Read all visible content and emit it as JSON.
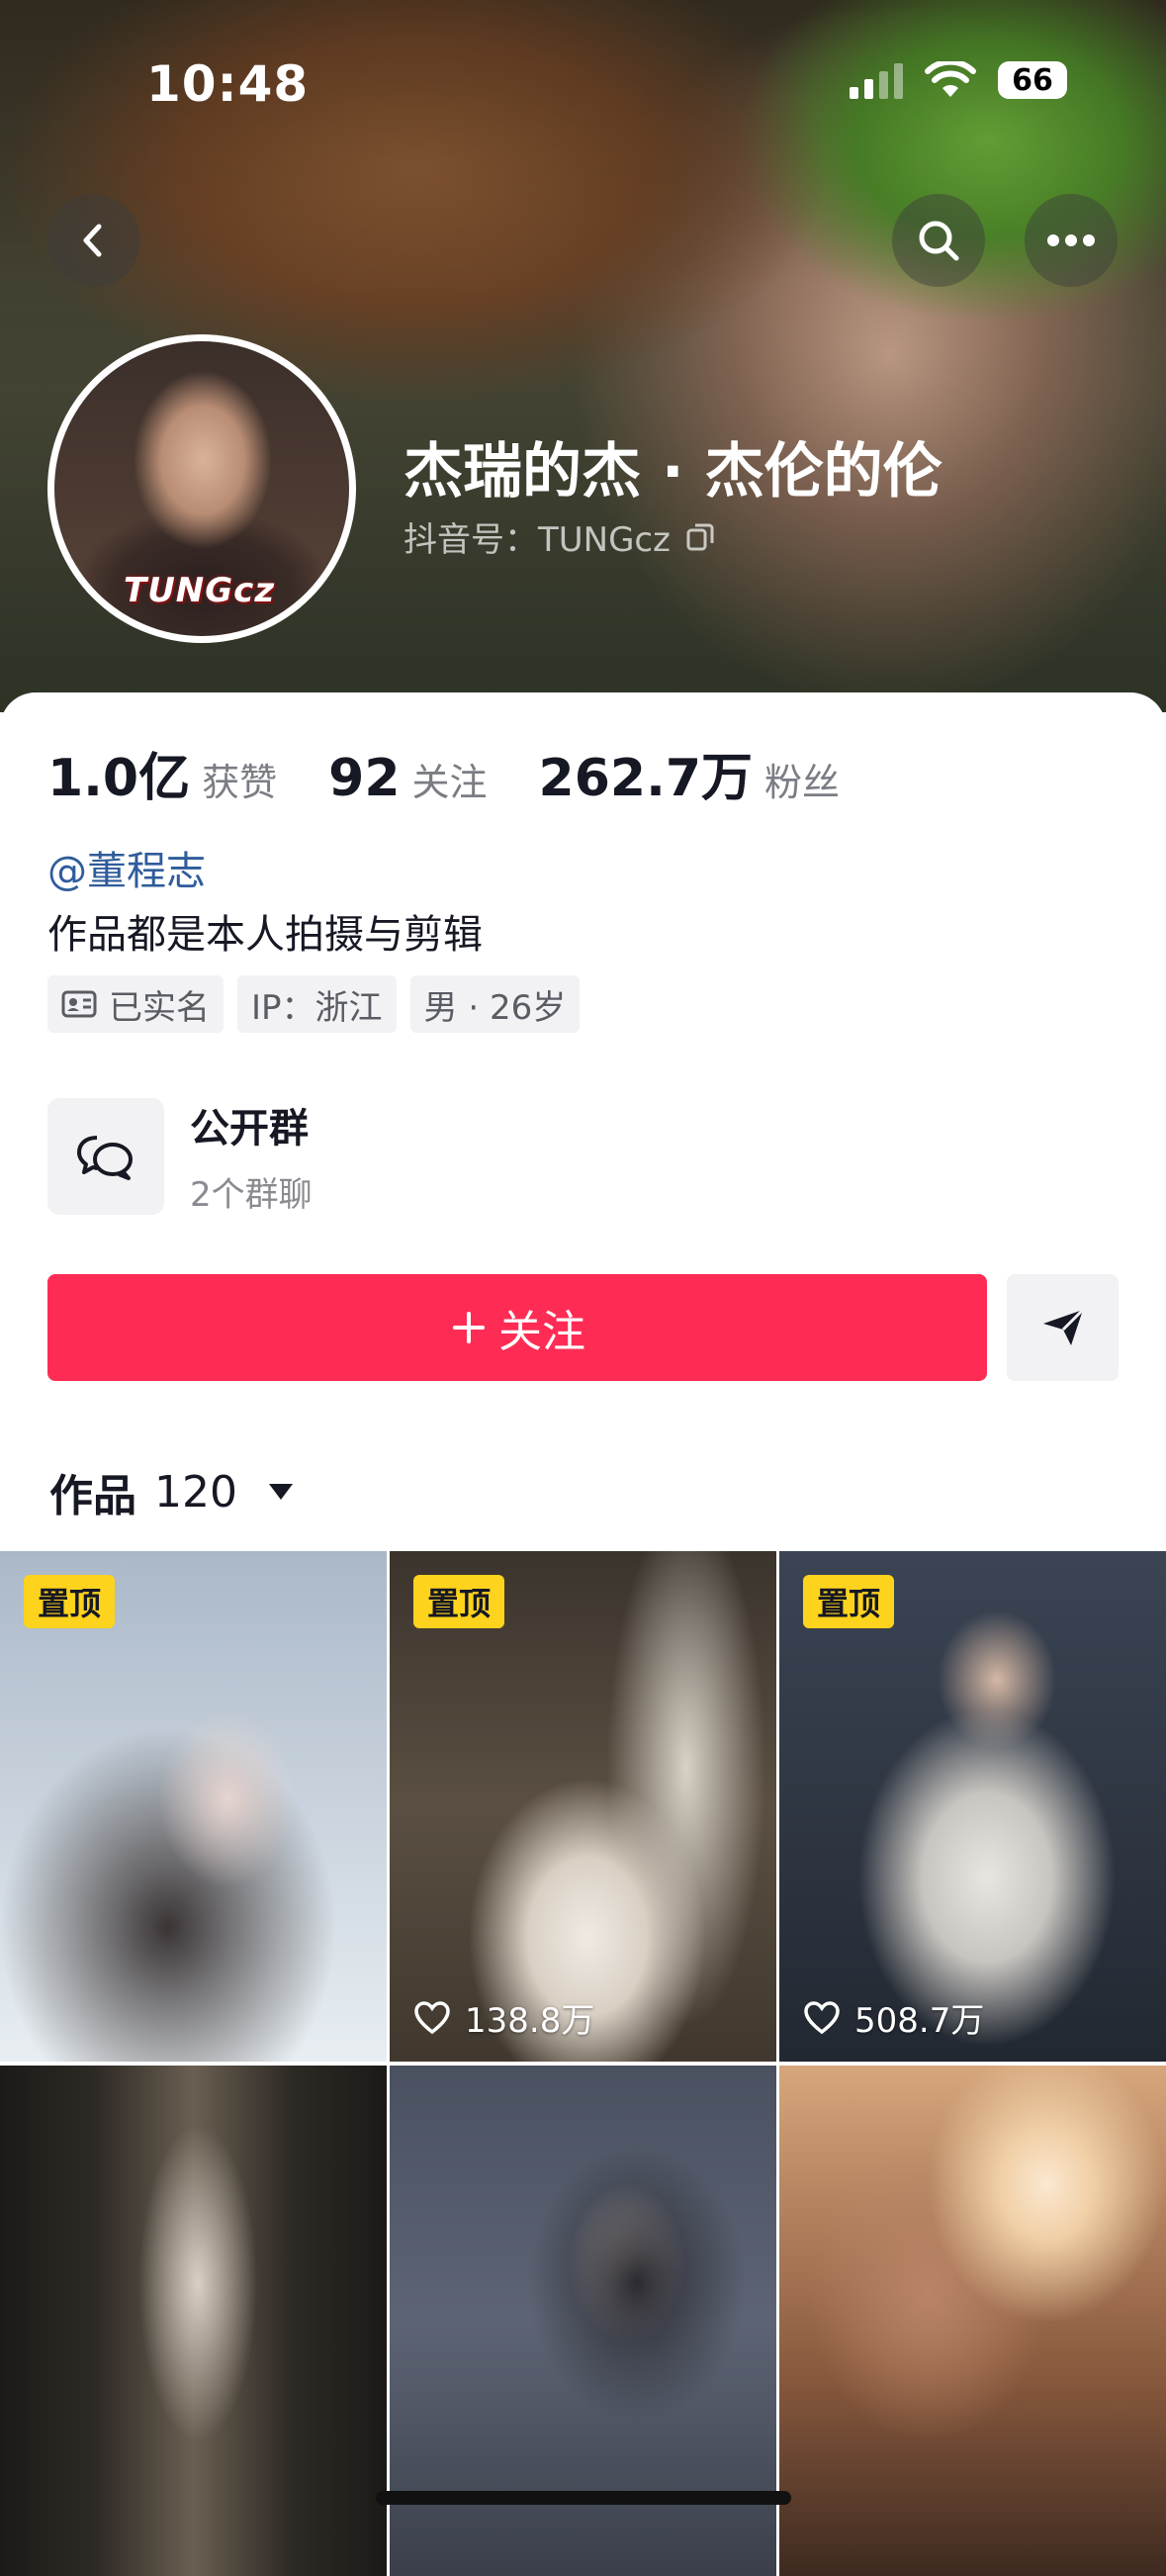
{
  "status_bar": {
    "time": "10:48",
    "battery": "66"
  },
  "profile": {
    "name": "杰瑞的杰 · 杰伦的伦",
    "douyin_id": "抖音号：TUNGcz",
    "avatar_logo": "TUNGcz",
    "stats": [
      {
        "value": "1.0亿",
        "label": "获赞"
      },
      {
        "value": "92",
        "label": "关注"
      },
      {
        "value": "262.7万",
        "label": "粉丝"
      }
    ],
    "mention": "@董程志",
    "bio": "作品都是本人拍摄与剪辑",
    "tags": [
      "已实名",
      "IP：浙江",
      "男 · 26岁"
    ]
  },
  "group": {
    "title": "公开群",
    "subtitle": "2个群聊"
  },
  "actions": {
    "follow_label": "关注"
  },
  "works": {
    "label": "作品",
    "count": "120",
    "items": [
      {
        "pinned": "置顶",
        "likes": ""
      },
      {
        "pinned": "置顶",
        "likes": "138.8万"
      },
      {
        "pinned": "置顶",
        "likes": "508.7万"
      },
      {
        "pinned": "",
        "likes": ""
      },
      {
        "pinned": "",
        "likes": ""
      },
      {
        "pinned": "",
        "likes": ""
      }
    ]
  },
  "colors": {
    "accent": "#fe2c55",
    "pin_badge": "#fdd31d",
    "mention": "#2f5c9b"
  }
}
